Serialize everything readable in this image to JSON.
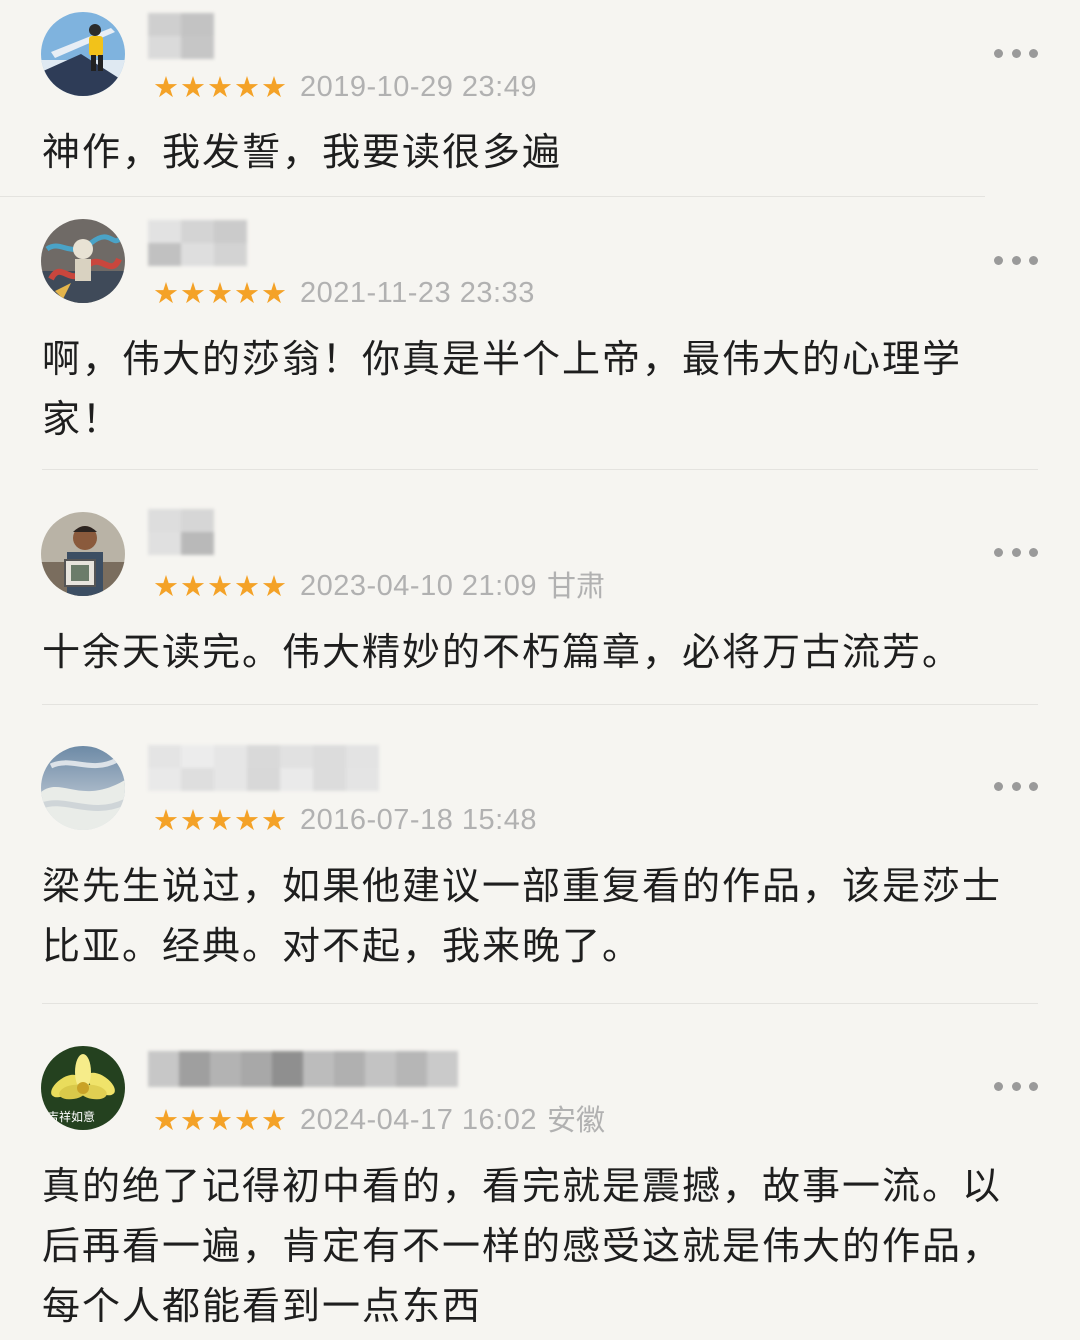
{
  "colors": {
    "background": "#f6f5f1",
    "star": "#f4a227",
    "meta_text": "#b1b1b1",
    "body_text": "#1e1e1e",
    "more_dots": "#9a9a9a"
  },
  "reviews": [
    {
      "avatar_icon": "skier-avatar-icon",
      "rating": 5,
      "stars": "★★★★★",
      "date": "2019-10-29 23:49",
      "location": "",
      "text": "神作，我发誓，我要读很多遍"
    },
    {
      "avatar_icon": "graffiti-art-avatar-icon",
      "rating": 5,
      "stars": "★★★★★",
      "date": "2021-11-23 23:33",
      "location": "",
      "text": "啊，伟大的莎翁！你真是半个上帝，最伟大的心理学家！"
    },
    {
      "avatar_icon": "portrait-photo-avatar-icon",
      "rating": 5,
      "stars": "★★★★★",
      "date": "2023-04-10 21:09",
      "location": "甘肃",
      "text": "十余天读完。伟大精妙的不朽篇章，必将万古流芳。"
    },
    {
      "avatar_icon": "sky-clouds-avatar-icon",
      "rating": 5,
      "stars": "★★★★★",
      "date": "2016-07-18 15:48",
      "location": "",
      "text": "梁先生说过，如果他建议一部重复看的作品，该是莎士比亚。经典。对不起，我来晚了。"
    },
    {
      "avatar_icon": "lotus-flower-avatar-icon",
      "avatar_caption": "吉祥如意",
      "rating": 5,
      "stars": "★★★★★",
      "date": "2024-04-17 16:02",
      "location": "安徽",
      "text": "真的绝了记得初中看的，看完就是震撼，故事一流。以后再看一遍，肯定有不一样的感受这就是伟大的作品，每个人都能看到一点东西"
    }
  ]
}
